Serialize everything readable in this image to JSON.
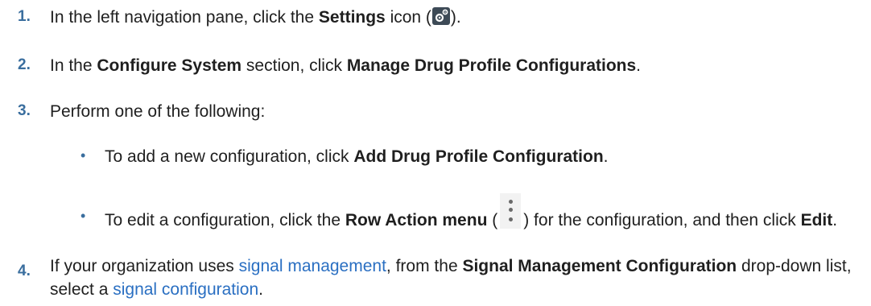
{
  "steps": [
    {
      "number": "1.",
      "pre": "In the left navigation pane, click the ",
      "bold1": "Settings",
      "mid": " icon (",
      "post": ")."
    },
    {
      "number": "2.",
      "pre": "In the ",
      "bold1": "Configure System",
      "mid": " section, click ",
      "bold2": "Manage Drug Profile Configurations",
      "post": "."
    },
    {
      "number": "3.",
      "text": "Perform one of the following:"
    },
    {
      "number": "4.",
      "pre": "If your organization uses ",
      "link1": "signal management",
      "mid": ", from the ",
      "bold1": "Signal Management Configuration",
      "mid2": " drop-down list, select a ",
      "link2": "signal configuration",
      "post": "."
    }
  ],
  "bullets": [
    {
      "symbol": "•",
      "pre": "To add a new configuration, click ",
      "bold1": "Add Drug Profile Configuration",
      "post": "."
    },
    {
      "symbol": "•",
      "pre": "To edit a configuration, click the ",
      "bold1": "Row Action menu",
      "mid": " (",
      "mid2": ") for the configuration, and then click ",
      "bold2": "Edit",
      "post": "."
    }
  ],
  "icons": {
    "settings": "gear-icon",
    "row_action": "kebab-icon"
  }
}
